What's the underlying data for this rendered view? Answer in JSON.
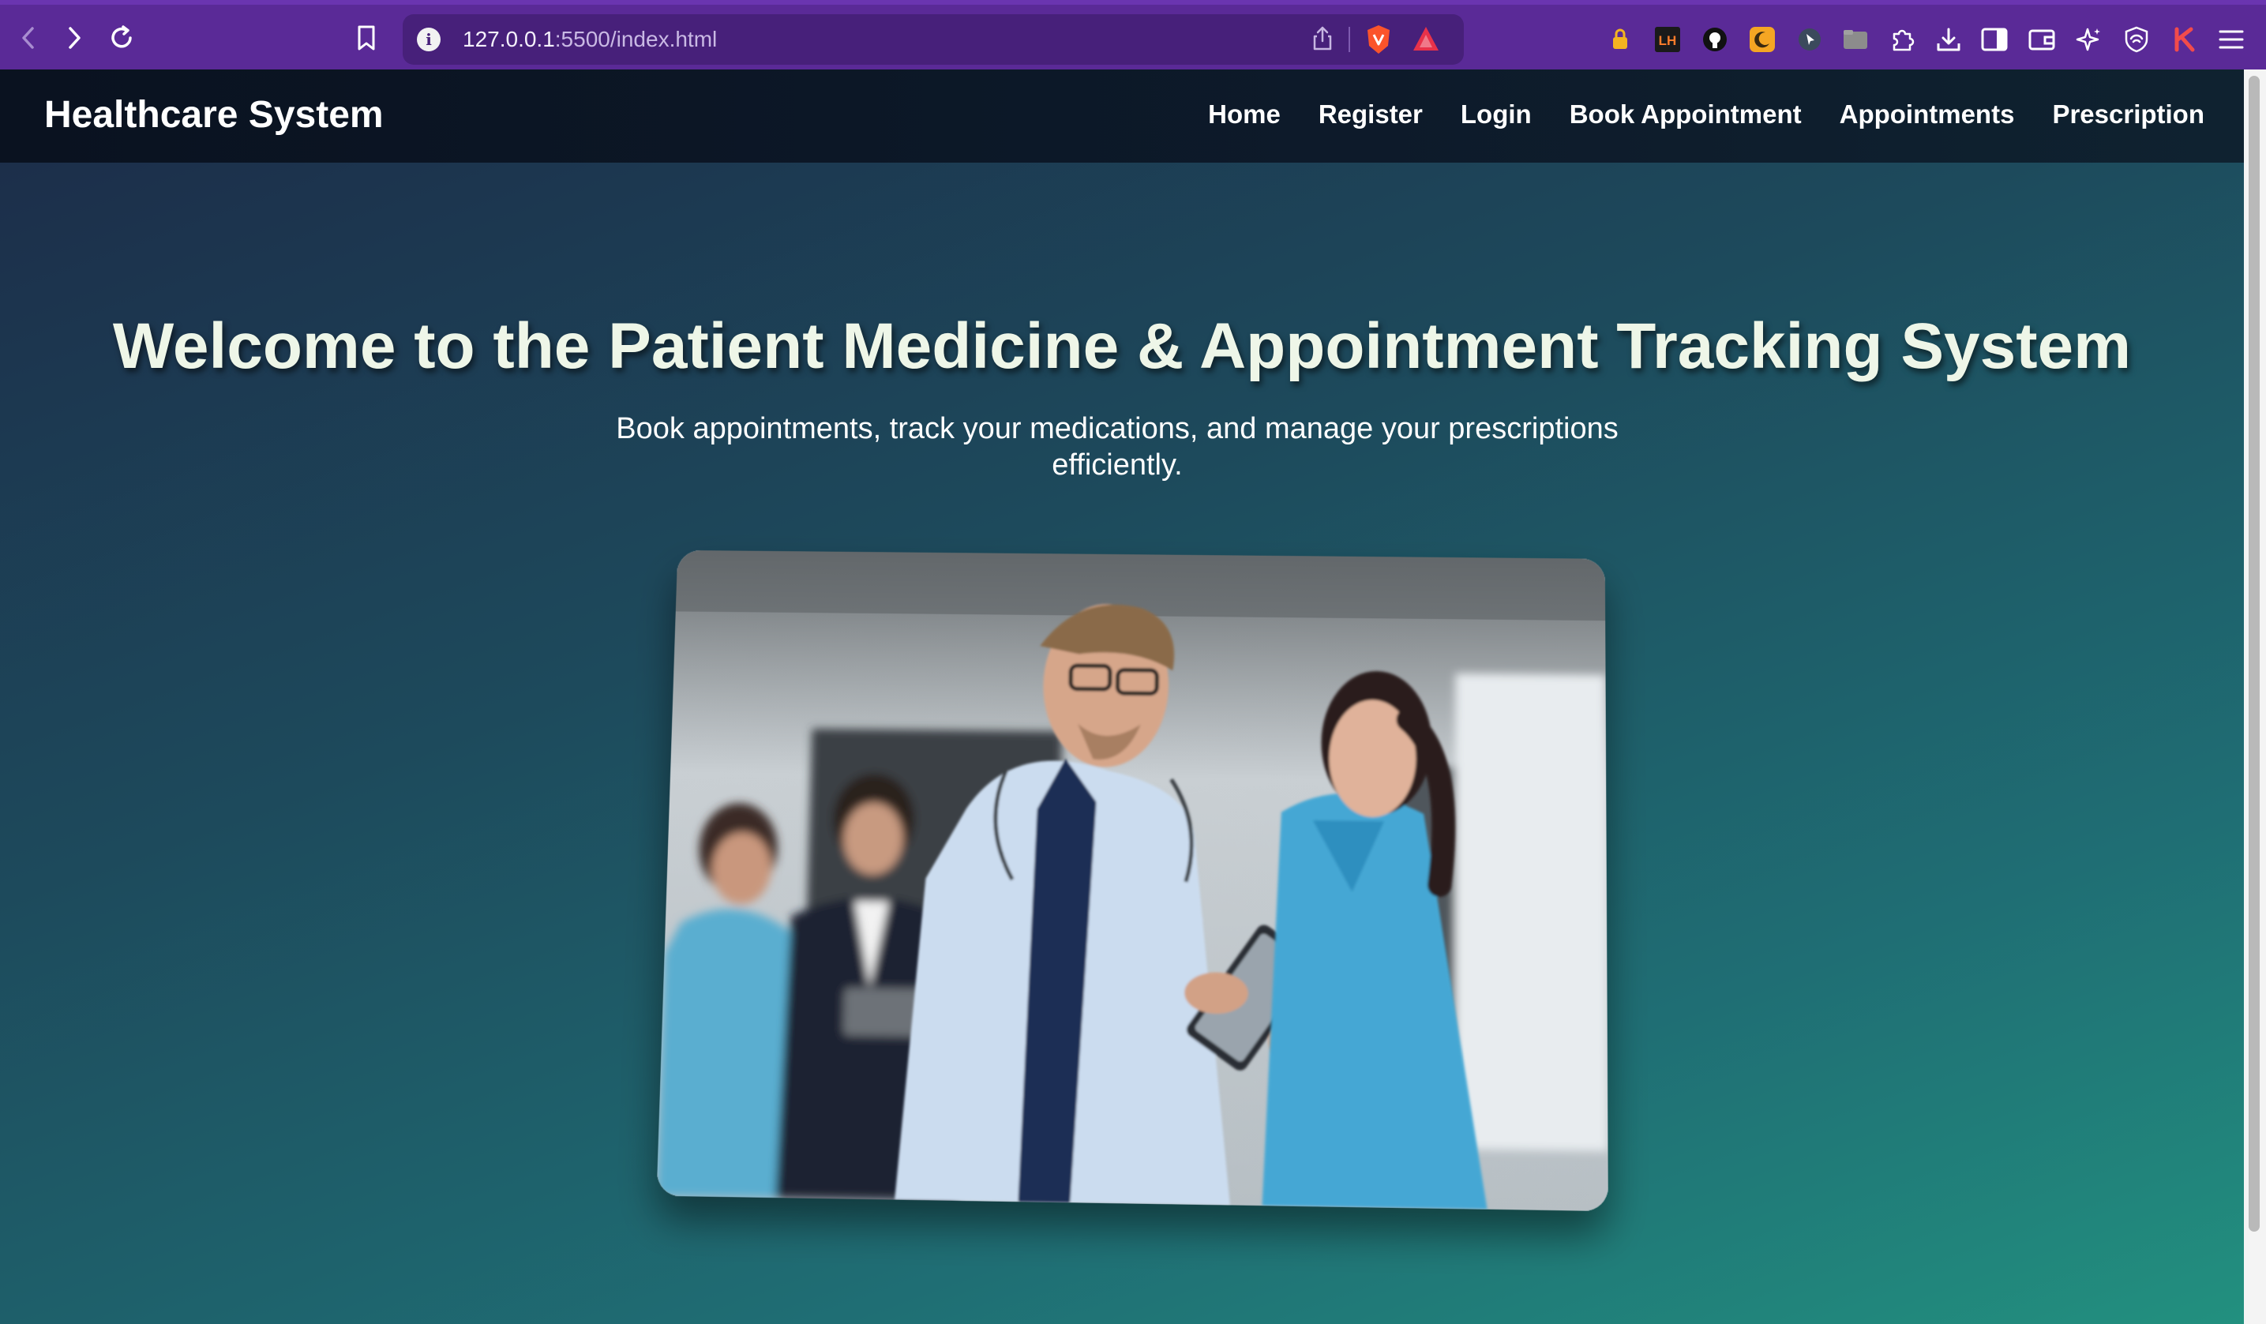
{
  "browser": {
    "url_host": "127.0.0.1",
    "url_rest": ":5500/index.html"
  },
  "site": {
    "brand": "Healthcare System",
    "nav": [
      {
        "label": "Home"
      },
      {
        "label": "Register"
      },
      {
        "label": "Login"
      },
      {
        "label": "Book Appointment"
      },
      {
        "label": "Appointments"
      },
      {
        "label": "Prescription"
      }
    ]
  },
  "hero": {
    "title": "Welcome to the Patient Medicine & Appointment Tracking System",
    "subtitle": "Book appointments, track your medications, and manage your prescriptions efficiently."
  },
  "colors": {
    "chrome": "#5a2a97",
    "navbar": "#0b1422",
    "gradient_start": "#1c2b48",
    "gradient_end": "#22907f"
  },
  "icons": {
    "back": "chevron-left-icon",
    "forward": "chevron-right-icon",
    "reload": "reload-icon",
    "bookmark": "bookmark-icon",
    "site_info": "info-icon"
  }
}
